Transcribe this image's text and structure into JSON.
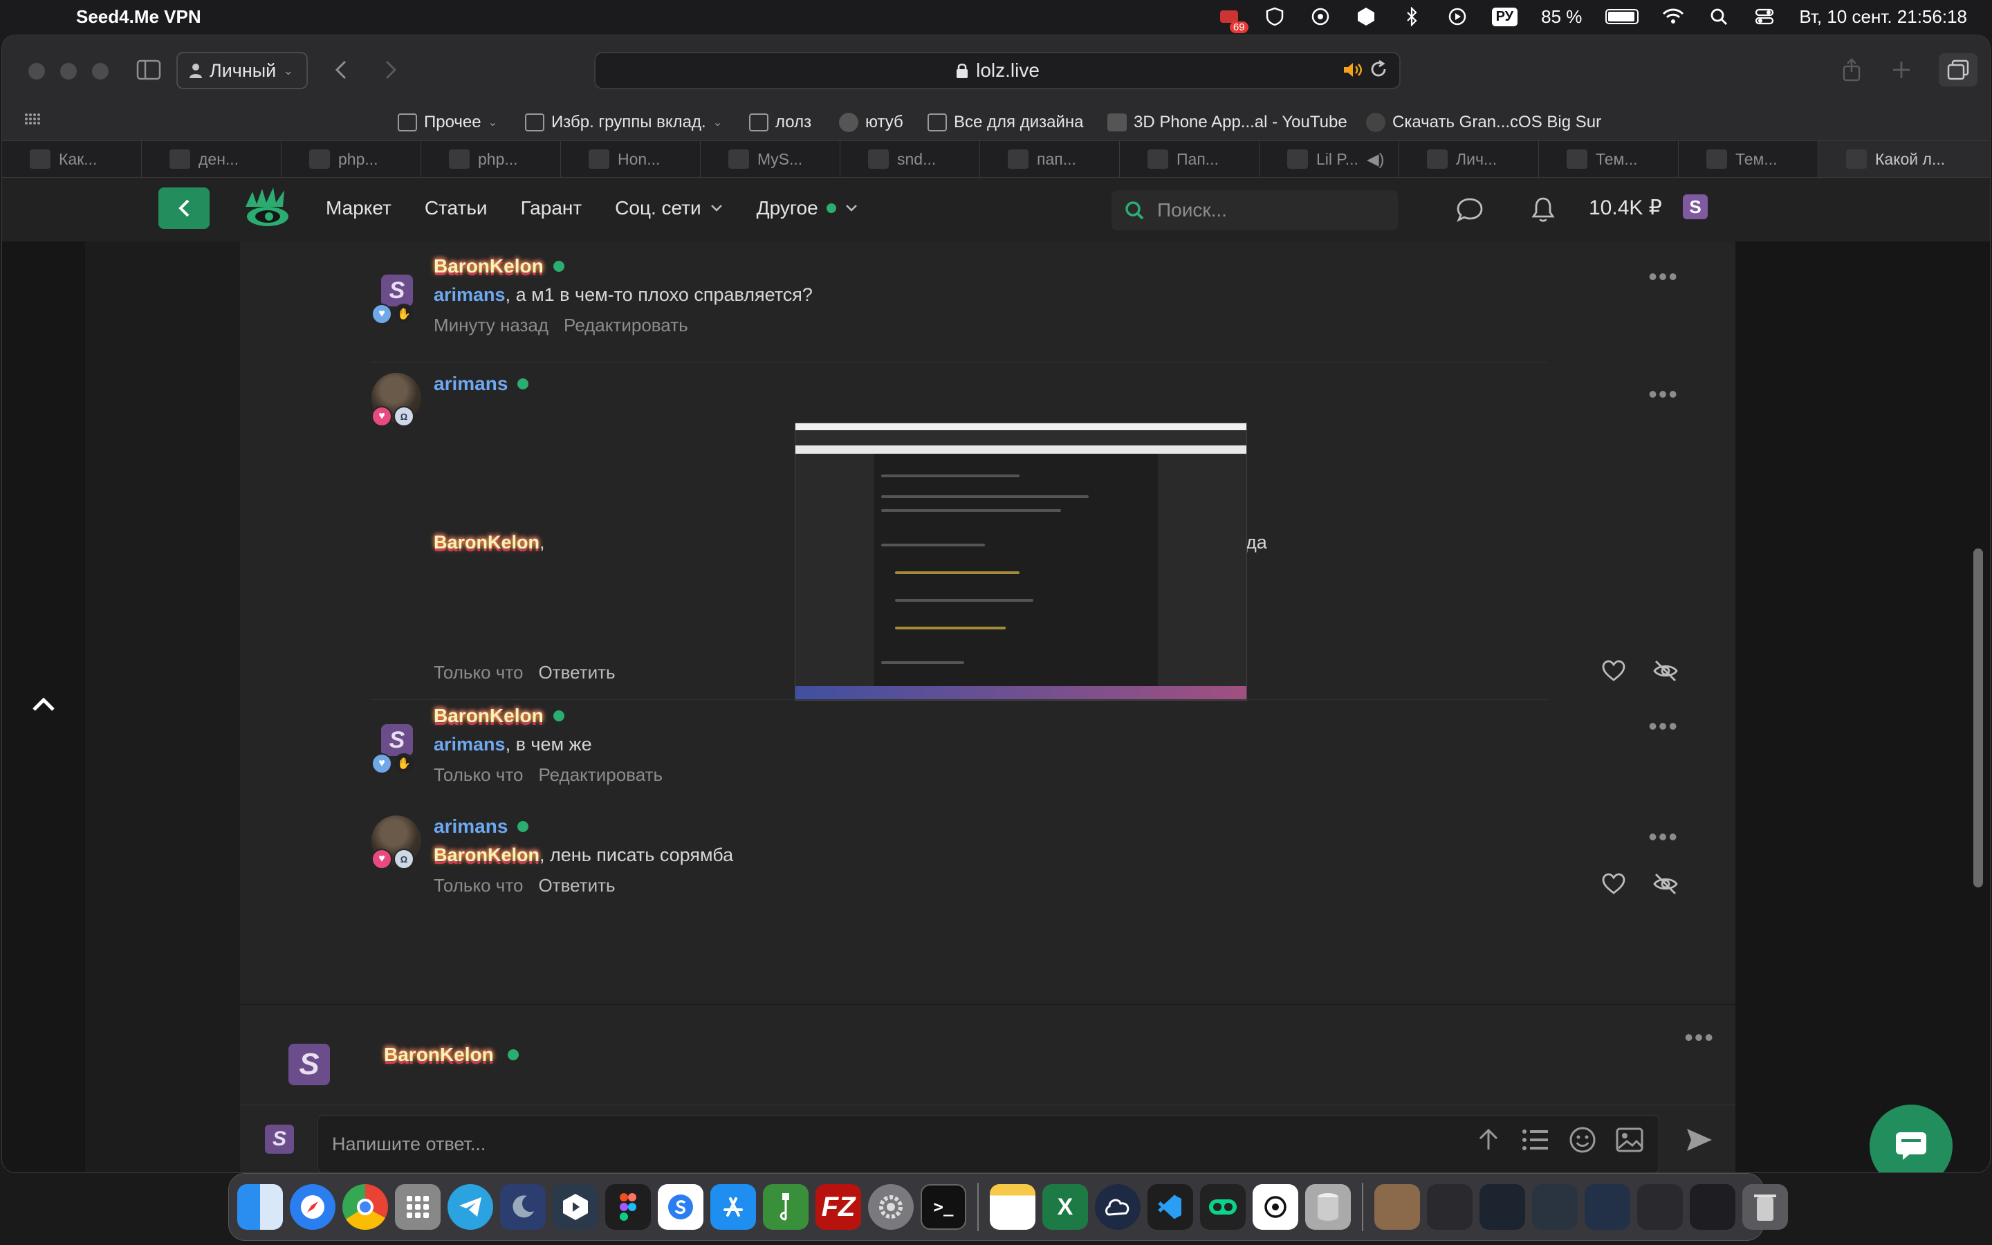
{
  "menubar": {
    "app_name": "Seed4.Me VPN",
    "notif_badge": "69",
    "keyboard_lang": "РУ",
    "battery": "85 %",
    "battery_level": 0.85,
    "datetime": "Вт, 10 сент.  21:56:18"
  },
  "browser": {
    "profile": "Личный",
    "url": "lolz.live",
    "bookmarks": [
      {
        "label": "Прочее",
        "icon": "folder-icon"
      },
      {
        "label": "Избр. группы вклад.",
        "icon": "folder-icon"
      },
      {
        "label": "лолз",
        "icon": "site-icon"
      },
      {
        "label": "ютуб",
        "icon": "google-icon"
      },
      {
        "label": "Все для дизайна",
        "icon": "site-icon"
      },
      {
        "label": "3D Phone App...al - YouTube",
        "icon": "youtube-icon"
      },
      {
        "label": "Скачать Gran...cOS Big Sur",
        "icon": "skull-icon"
      }
    ],
    "tabs": [
      "Как...",
      "ден...",
      "php...",
      "php...",
      "Hon...",
      "MyS...",
      "snd...",
      "пап...",
      "Пап...",
      "Lil P...",
      "Лич...",
      "Тем...",
      "Тем...",
      "Какой л..."
    ]
  },
  "site": {
    "nav": [
      "Маркет",
      "Статьи",
      "Гарант",
      "Соц. сети",
      "Другое"
    ],
    "search_placeholder": "Поиск...",
    "balance": "10.4K ₽"
  },
  "comments": [
    {
      "author": "BaronKelon",
      "mention": "arimans",
      "text": ", а м1 в чем-то плохо справляется?",
      "time": "Минуту назад",
      "action": "Редактировать"
    },
    {
      "author": "arimans",
      "mention": "BaronKelon",
      "text_before": ",",
      "text_after": "да",
      "time": "Только что",
      "action": "Ответить"
    },
    {
      "author": "BaronKelon",
      "mention": "arimans",
      "text": ", в чем же",
      "time": "Только что",
      "action": "Редактировать"
    },
    {
      "author": "arimans",
      "mention": "BaronKelon",
      "text": ", лень писать сорямба",
      "time": "Только что",
      "action": "Ответить"
    }
  ],
  "next_post_author": "BaronKelon",
  "reply": {
    "placeholder": "Напишите ответ..."
  },
  "colors": {
    "accent": "#228e5d",
    "online": "#2bad72",
    "mention_blue": "#6ea8f0"
  }
}
